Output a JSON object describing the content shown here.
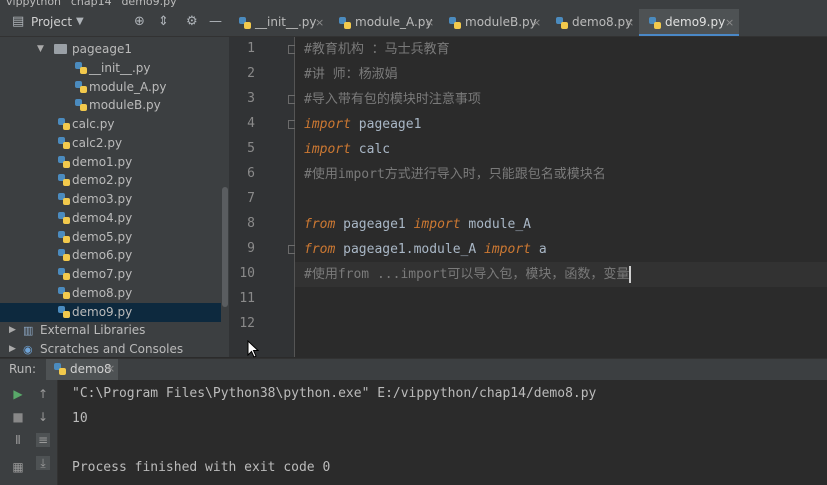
{
  "breadcrumb": [
    "vippython",
    "chap14",
    "demo9.py"
  ],
  "project_panel": {
    "title": "Project",
    "tree": [
      {
        "label": "pageage1",
        "type": "folder",
        "indent": 1,
        "expanded": true
      },
      {
        "label": "__init__.py",
        "type": "py",
        "indent": 2
      },
      {
        "label": "module_A.py",
        "type": "py",
        "indent": 2
      },
      {
        "label": "moduleB.py",
        "type": "py",
        "indent": 2
      },
      {
        "label": "calc.py",
        "type": "py",
        "indent": 1
      },
      {
        "label": "calc2.py",
        "type": "py",
        "indent": 1
      },
      {
        "label": "demo1.py",
        "type": "py",
        "indent": 1
      },
      {
        "label": "demo2.py",
        "type": "py",
        "indent": 1
      },
      {
        "label": "demo3.py",
        "type": "py",
        "indent": 1
      },
      {
        "label": "demo4.py",
        "type": "py",
        "indent": 1
      },
      {
        "label": "demo5.py",
        "type": "py",
        "indent": 1
      },
      {
        "label": "demo6.py",
        "type": "py",
        "indent": 1
      },
      {
        "label": "demo7.py",
        "type": "py",
        "indent": 1
      },
      {
        "label": "demo8.py",
        "type": "py",
        "indent": 1
      },
      {
        "label": "demo9.py",
        "type": "py",
        "indent": 1,
        "selected": true
      },
      {
        "label": "External Libraries",
        "type": "lib",
        "indent": 0
      },
      {
        "label": "Scratches and Consoles",
        "type": "scratch",
        "indent": 0
      }
    ]
  },
  "tabs": [
    {
      "label": "__init__.py",
      "active": false
    },
    {
      "label": "module_A.py",
      "active": false
    },
    {
      "label": "moduleB.py",
      "active": false
    },
    {
      "label": "demo8.py",
      "active": false
    },
    {
      "label": "demo9.py",
      "active": true
    }
  ],
  "editor": {
    "current_line": 10,
    "lines": [
      {
        "n": "1",
        "parts": [
          {
            "t": "#教育机构 ：马士兵教育",
            "c": "cm"
          }
        ]
      },
      {
        "n": "2",
        "parts": [
          {
            "t": "#讲      师：杨淑娟",
            "c": "cm"
          }
        ]
      },
      {
        "n": "3",
        "parts": [
          {
            "t": "#导入带有包的模块时注意事项",
            "c": "cm"
          }
        ]
      },
      {
        "n": "4",
        "parts": [
          {
            "t": "import",
            "c": "kw"
          },
          {
            "t": " pageage1",
            "c": "id"
          }
        ]
      },
      {
        "n": "5",
        "parts": [
          {
            "t": "import",
            "c": "kw"
          },
          {
            "t": "  calc",
            "c": "id"
          }
        ]
      },
      {
        "n": "6",
        "parts": [
          {
            "t": "#使用import方式进行导入时，只能跟包名或模块名",
            "c": "cm"
          }
        ]
      },
      {
        "n": "7",
        "parts": []
      },
      {
        "n": "8",
        "parts": [
          {
            "t": "from",
            "c": "kw"
          },
          {
            "t": " pageage1 ",
            "c": "id"
          },
          {
            "t": "import",
            "c": "kw"
          },
          {
            "t": "  module_A",
            "c": "id"
          }
        ]
      },
      {
        "n": "9",
        "parts": [
          {
            "t": "from",
            "c": "kw"
          },
          {
            "t": " pageage1.module_A ",
            "c": "id"
          },
          {
            "t": "import",
            "c": "kw"
          },
          {
            "t": "  a",
            "c": "id"
          }
        ]
      },
      {
        "n": "10",
        "parts": [
          {
            "t": "#使用from ...import可以导入包，模块，函数，变量",
            "c": "cm"
          }
        ]
      },
      {
        "n": "11",
        "parts": []
      },
      {
        "n": "12",
        "parts": []
      }
    ]
  },
  "run": {
    "label": "Run:",
    "tab": "demo8",
    "output": [
      "\"C:\\Program Files\\Python38\\python.exe\" E:/vippython/chap14/demo8.py",
      "10",
      "",
      "Process finished with exit code 0"
    ]
  }
}
